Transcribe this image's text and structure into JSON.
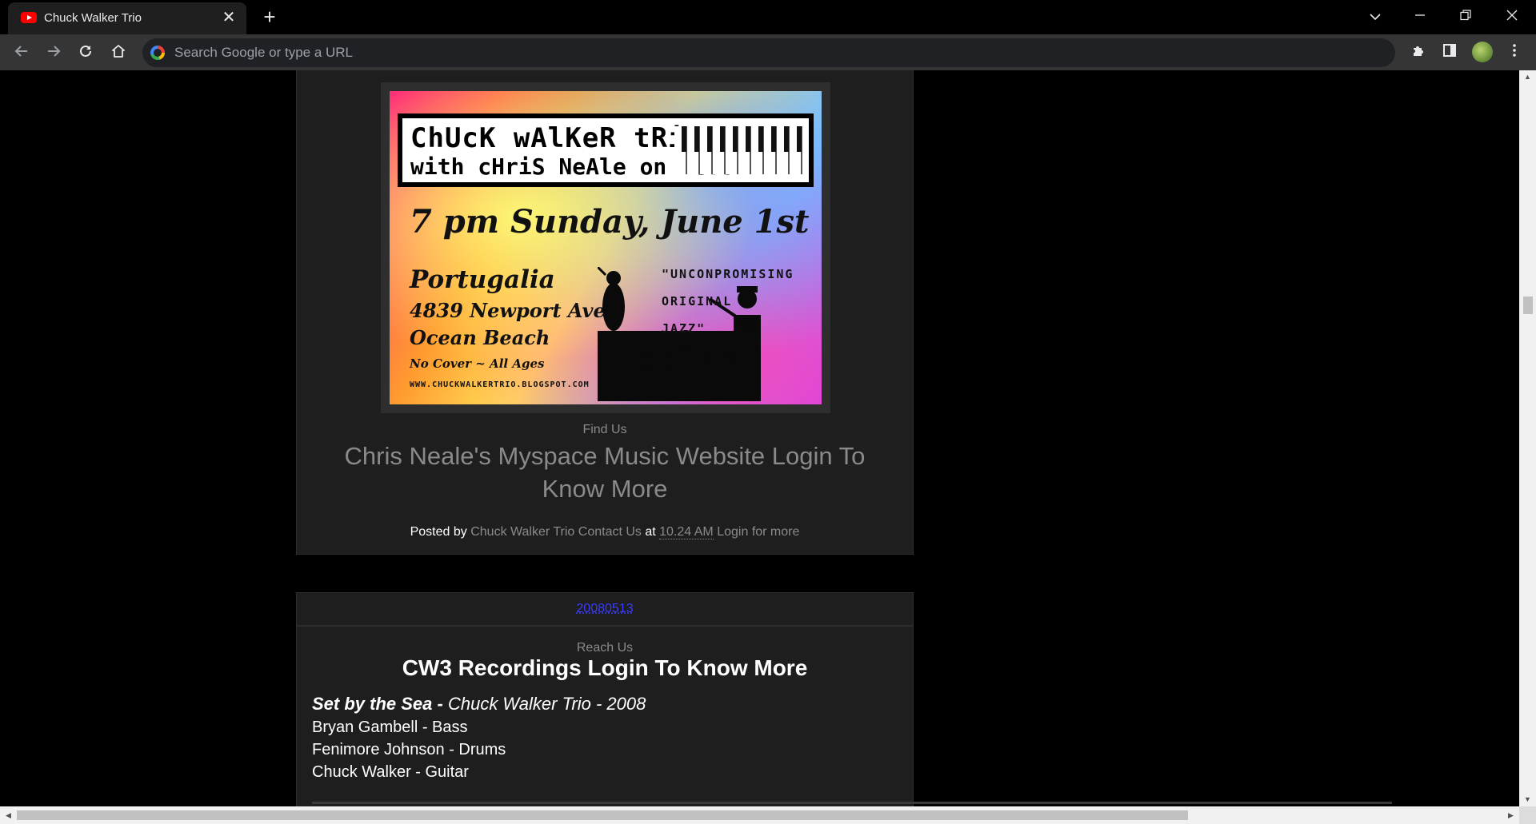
{
  "browser": {
    "tab_title": "Chuck Walker Trio",
    "tab_close_glyph": "✕",
    "new_tab_glyph": "+",
    "omnibox_placeholder": "Search Google or type a URL",
    "icons": [
      "youtube-favicon",
      "close-icon",
      "plus-icon",
      "tab-search-icon",
      "minimize-icon",
      "restore-icon",
      "close-window-icon",
      "back-icon",
      "forward-icon",
      "reload-icon",
      "home-icon",
      "google-icon",
      "extensions-icon",
      "side-panel-icon",
      "profile-avatar",
      "menu-icon"
    ]
  },
  "flyer": {
    "line1": "ChUcK wAlKeR tRio",
    "line2": "with cHriS NeAle on keYs",
    "date": "7 pm Sunday, June 1st",
    "venue": "Portugalia",
    "address": "4839 Newport Ave",
    "city": "Ocean Beach",
    "cover": "No Cover ~ All Ages",
    "url": "WWW.CHUCKWALKERTRIO.BLOGSPOT.COM",
    "quote_l1": "\"UNCONPROMISING",
    "quote_l2": "ORIGINAL",
    "quote_l3": "JAZZ\""
  },
  "post1": {
    "label": "Find Us",
    "title": "Chris Neale's Myspace Music Website Login To Know More",
    "footer_posted_by": "Posted by",
    "footer_author": "Chuck Walker Trio Contact Us",
    "footer_at": "at",
    "footer_time": "10.24 AM",
    "footer_login": "Login for more"
  },
  "date_header": "20080513",
  "post2": {
    "label": "Reach Us",
    "title": "CW3 Recordings Login To Know More",
    "album_title": "Set by the Sea -",
    "album_rest": " Chuck Walker Trio - 2008",
    "credits": [
      "Bryan Gambell - Bass",
      "Fenimore Johnson - Drums",
      "Chuck Walker - Guitar"
    ]
  },
  "colors": {
    "page_background": "#000000",
    "post_background": "#1e1e1e",
    "muted_link": "#8a8a8a",
    "date_link": "#3b3bff"
  }
}
